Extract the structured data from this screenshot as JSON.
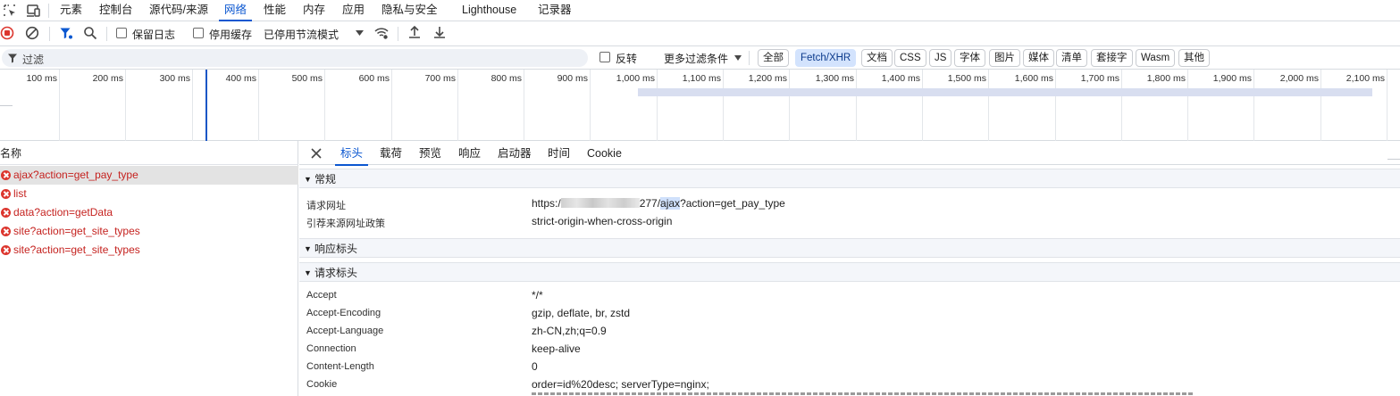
{
  "top_tabs": [
    "元素",
    "控制台",
    "源代码/来源",
    "网络",
    "性能",
    "内存",
    "应用",
    "隐私与安全",
    "Lighthouse",
    "记录器"
  ],
  "toolbar": {
    "preserve_log": "保留日志",
    "disable_cache": "停用缓存",
    "throttling": "已停用节流模式"
  },
  "filter": {
    "placeholder": "过滤",
    "invert": "反转",
    "more_filters": "更多过滤条件",
    "chips": [
      "全部",
      "Fetch/XHR",
      "文档",
      "CSS",
      "JS",
      "字体",
      "图片",
      "媒体",
      "清单",
      "套接字",
      "Wasm",
      "其他"
    ],
    "active_chip": "Fetch/XHR"
  },
  "timeline": {
    "ticks": [
      "100 ms",
      "200 ms",
      "300 ms",
      "400 ms",
      "500 ms",
      "600 ms",
      "700 ms",
      "800 ms",
      "900 ms",
      "1,000 ms",
      "1,100 ms",
      "1,200 ms",
      "1,300 ms",
      "1,400 ms",
      "1,500 ms",
      "1,600 ms",
      "1,700 ms",
      "1,800 ms",
      "1,900 ms",
      "2,000 ms",
      "2,100 ms"
    ]
  },
  "request_list": {
    "header": "名称",
    "items": [
      "ajax?action=get_pay_type",
      "list",
      "data?action=getData",
      "site?action=get_site_types",
      "site?action=get_site_types"
    ]
  },
  "detail_tabs": [
    "标头",
    "载荷",
    "预览",
    "响应",
    "启动器",
    "时间",
    "Cookie"
  ],
  "general": {
    "title": "常规",
    "url_label": "请求网址",
    "url_prefix": "https:/",
    "url_port": "277/",
    "url_path": "ajax",
    "url_query": "?action=get_pay_type",
    "referrer_label": "引荐来源网址政策",
    "referrer_value": "strict-origin-when-cross-origin"
  },
  "response_headers_title": "响应标头",
  "request_headers": {
    "title": "请求标头",
    "rows": [
      {
        "k": "Accept",
        "v": "*/*"
      },
      {
        "k": "Accept-Encoding",
        "v": "gzip, deflate, br, zstd"
      },
      {
        "k": "Accept-Language",
        "v": "zh-CN,zh;q=0.9"
      },
      {
        "k": "Connection",
        "v": "keep-alive"
      },
      {
        "k": "Content-Length",
        "v": "0"
      },
      {
        "k": "Cookie",
        "v": "order=id%20desc; serverType=nginx;"
      }
    ]
  }
}
